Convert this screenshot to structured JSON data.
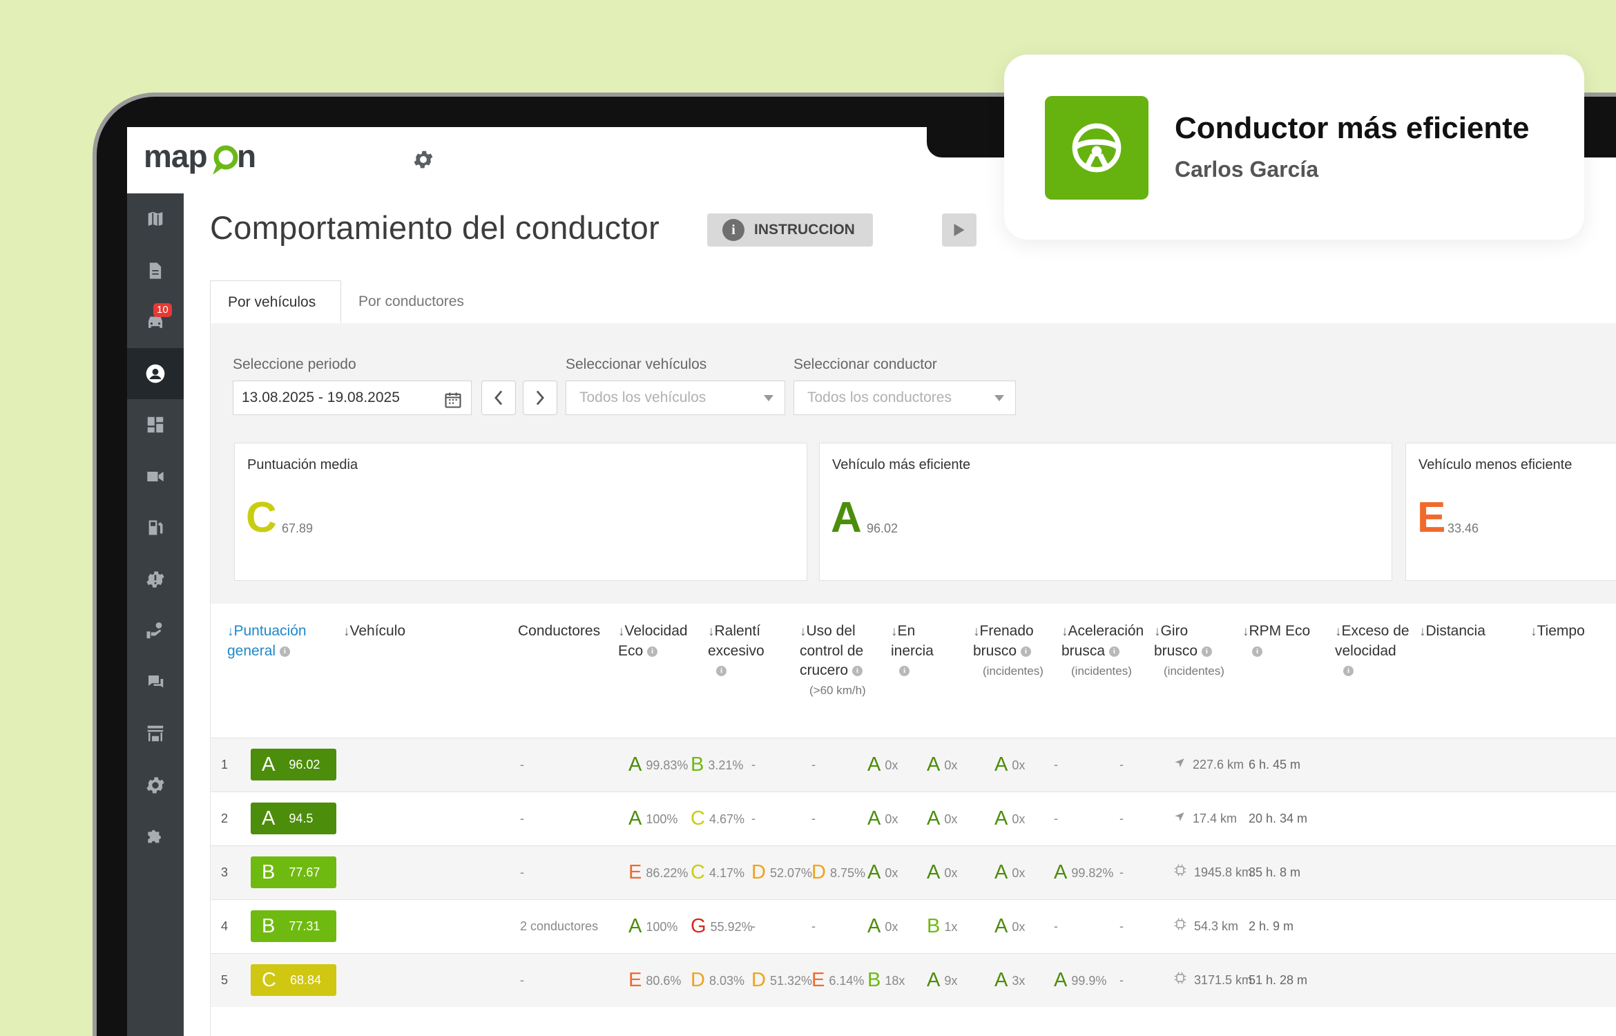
{
  "brand": {
    "logo_text": "mapon",
    "accent": "#6cb819"
  },
  "sidebar": {
    "items": [
      {
        "name": "map-icon"
      },
      {
        "name": "document-icon"
      },
      {
        "name": "car-icon",
        "badge": "10"
      },
      {
        "name": "user-circle-icon",
        "active": true
      },
      {
        "name": "dashboard-icon"
      },
      {
        "name": "video-icon"
      },
      {
        "name": "fuel-icon"
      },
      {
        "name": "alert-gear-icon"
      },
      {
        "name": "hand-money-icon"
      },
      {
        "name": "chat-icon"
      },
      {
        "name": "store-icon"
      },
      {
        "name": "settings-icon"
      },
      {
        "name": "puzzle-icon"
      }
    ]
  },
  "header": {
    "title": "Comportamiento del conductor",
    "instruction_label": "INSTRUCCION"
  },
  "tabs": [
    {
      "label": "Por vehículos",
      "active": true
    },
    {
      "label": "Por conductores",
      "active": false
    }
  ],
  "filters": {
    "period_label": "Seleccione periodo",
    "period_value": "13.08.2025 - 19.08.2025",
    "vehicles_label": "Seleccionar vehículos",
    "vehicles_placeholder": "Todos los vehículos",
    "driver_label": "Seleccionar conductor",
    "driver_placeholder": "Todos los conductores"
  },
  "summary": [
    {
      "title": "Puntuación media",
      "grade": "C",
      "score": "67.89",
      "color": "#c8cd12"
    },
    {
      "title": "Vehículo más eficiente",
      "grade": "A",
      "score": "96.02",
      "color": "#4c8d0b"
    },
    {
      "title": "Vehículo menos eficiente",
      "grade": "E",
      "score": "33.46",
      "color": "#f06a2c"
    }
  ],
  "table": {
    "columns": {
      "score": "Puntuación general",
      "vehicle": "Vehículo",
      "drivers": "Conductores",
      "eco_speed": "Velocidad Eco",
      "idle": "Ralentí excesivo",
      "cruise": "Uso del control de crucero",
      "cruise_sub": "(>60 km/h)",
      "coast": "En inercia",
      "braking": "Frenado brusco",
      "accel": "Aceleración brusca",
      "turn": "Giro brusco",
      "incidents_sub": "(incidentes)",
      "rpm": "RPM Eco",
      "overspeed": "Exceso de velocidad",
      "distance": "Distancia",
      "time": "Tiempo"
    },
    "rows": [
      {
        "idx": "1",
        "grade": "A",
        "score": "96.02",
        "pill": "#4c8d0b",
        "drivers": "-",
        "eco": [
          "A",
          "99.83%"
        ],
        "idle": [
          "B",
          "3.21%"
        ],
        "cruise": [
          "",
          "-"
        ],
        "coast": [
          "",
          "-"
        ],
        "brake": [
          "A",
          "0x"
        ],
        "accel": [
          "A",
          "0x"
        ],
        "turn": [
          "A",
          "0x"
        ],
        "rpm": [
          "",
          "-"
        ],
        "over": "-",
        "dist_icon": "navigation-arrow-icon",
        "dist": "227.6 km",
        "time": "6 h. 45 m"
      },
      {
        "idx": "2",
        "grade": "A",
        "score": "94.5",
        "pill": "#4c8d0b",
        "drivers": "-",
        "eco": [
          "A",
          "100%"
        ],
        "idle": [
          "C",
          "4.67%"
        ],
        "cruise": [
          "",
          "-"
        ],
        "coast": [
          "",
          "-"
        ],
        "brake": [
          "A",
          "0x"
        ],
        "accel": [
          "A",
          "0x"
        ],
        "turn": [
          "A",
          "0x"
        ],
        "rpm": [
          "",
          "-"
        ],
        "over": "-",
        "dist_icon": "navigation-arrow-icon",
        "dist": "17.4 km",
        "time": "20 h. 34 m"
      },
      {
        "idx": "3",
        "grade": "B",
        "score": "77.67",
        "pill": "#6fba10",
        "drivers": "-",
        "eco": [
          "E",
          "86.22%"
        ],
        "idle": [
          "C",
          "4.17%"
        ],
        "cruise": [
          "D",
          "52.07%"
        ],
        "coast": [
          "D",
          "8.75%"
        ],
        "brake": [
          "A",
          "0x"
        ],
        "accel": [
          "A",
          "0x"
        ],
        "turn": [
          "A",
          "0x"
        ],
        "rpm": [
          "A",
          "99.82%"
        ],
        "over": "-",
        "dist_icon": "chip-icon",
        "dist": "1945.8 km",
        "time": "35 h. 8 m"
      },
      {
        "idx": "4",
        "grade": "B",
        "score": "77.31",
        "pill": "#6fba10",
        "drivers": "2 conductores",
        "eco": [
          "A",
          "100%"
        ],
        "idle": [
          "G",
          "55.92%"
        ],
        "cruise": [
          "",
          "-"
        ],
        "coast": [
          "",
          "-"
        ],
        "brake": [
          "A",
          "0x"
        ],
        "accel": [
          "B",
          "1x"
        ],
        "turn": [
          "A",
          "0x"
        ],
        "rpm": [
          "",
          "-"
        ],
        "over": "-",
        "dist_icon": "chip-icon",
        "dist": "54.3 km",
        "time": "2 h. 9 m"
      },
      {
        "idx": "5",
        "grade": "C",
        "score": "68.84",
        "pill": "#cfc712",
        "drivers": "-",
        "eco": [
          "E",
          "80.6%"
        ],
        "idle": [
          "D",
          "8.03%"
        ],
        "cruise": [
          "D",
          "51.32%"
        ],
        "coast": [
          "E",
          "6.14%"
        ],
        "brake": [
          "B",
          "18x"
        ],
        "accel": [
          "A",
          "9x"
        ],
        "turn": [
          "A",
          "3x"
        ],
        "rpm": [
          "A",
          "99.9%"
        ],
        "over": "-",
        "dist_icon": "chip-icon",
        "dist": "3171.5 km",
        "time": "51 h. 28 m"
      }
    ]
  },
  "notification": {
    "title": "Conductor más eficiente",
    "name": "Carlos García"
  }
}
